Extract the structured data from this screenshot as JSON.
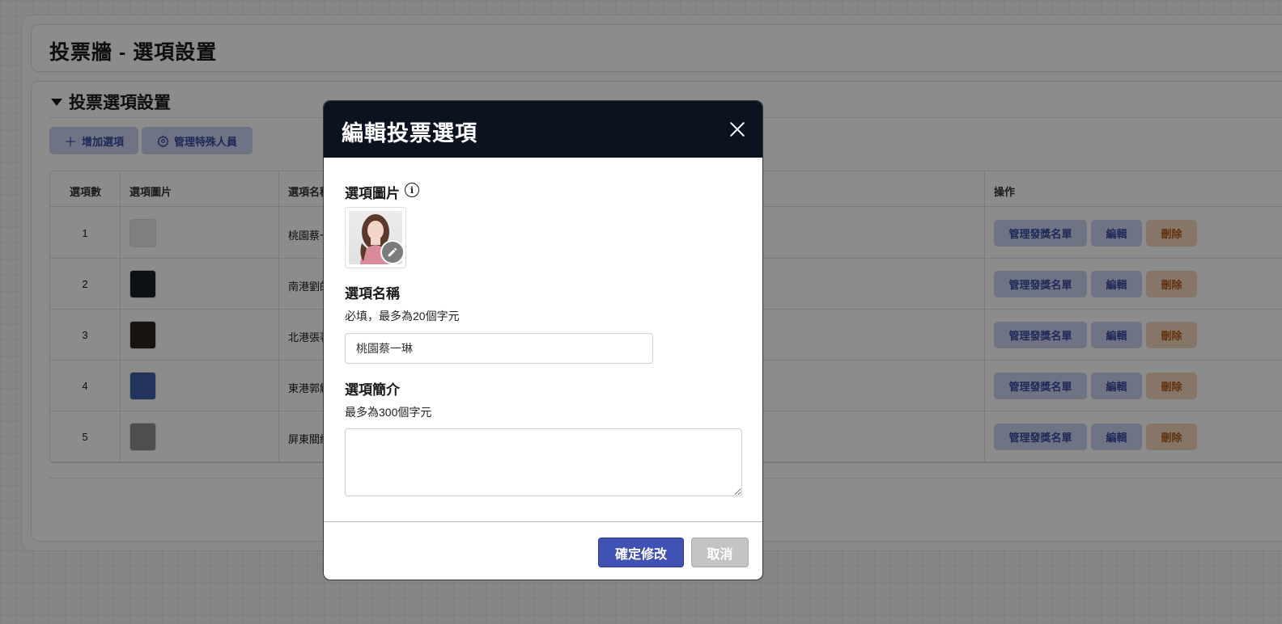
{
  "page": {
    "title": "投票牆 - 選項設置",
    "section_title": "投票選項設置"
  },
  "toolbar": {
    "add_label": "增加選項",
    "manage_label": "管理特殊人員"
  },
  "table": {
    "headers": [
      "選項數",
      "選項圖片",
      "選項名稱",
      "操作"
    ],
    "rows": [
      {
        "num": "1",
        "name": "桃園蔡一",
        "thumb_color": "#e9e5e6"
      },
      {
        "num": "2",
        "name": "南港劉的",
        "thumb_color": "#1b1f26"
      },
      {
        "num": "3",
        "name": "北港張著",
        "thumb_color": "#2a2420"
      },
      {
        "num": "4",
        "name": "東港郭觧",
        "thumb_color": "#3b5fa8"
      },
      {
        "num": "5",
        "name": "屏東關緘",
        "thumb_color": "#8e8e8e"
      }
    ],
    "actions": {
      "award_label": "管理發獎名單",
      "edit_label": "編輯",
      "delete_label": "刪除"
    }
  },
  "modal": {
    "title": "編輯投票選項",
    "image_label": "選項圖片",
    "name_label": "選項名稱",
    "name_hint": "必填，最多為20個字元",
    "name_value": "桃園蔡一琳",
    "desc_label": "選項簡介",
    "desc_hint": "最多為300個字元",
    "desc_value": "",
    "confirm_label": "確定修改",
    "cancel_label": "取消"
  },
  "icons": {
    "add": "plus-icon",
    "manage": "gear-icon",
    "section": "caret-down-icon",
    "info": "info-icon",
    "close": "close-icon",
    "edit_image": "pencil-icon"
  },
  "colors": {
    "modal_header": "#0b1220",
    "primary": "#4152b5",
    "secondary_btn": "#c9d3f1",
    "danger_btn": "#f3d8bd"
  }
}
